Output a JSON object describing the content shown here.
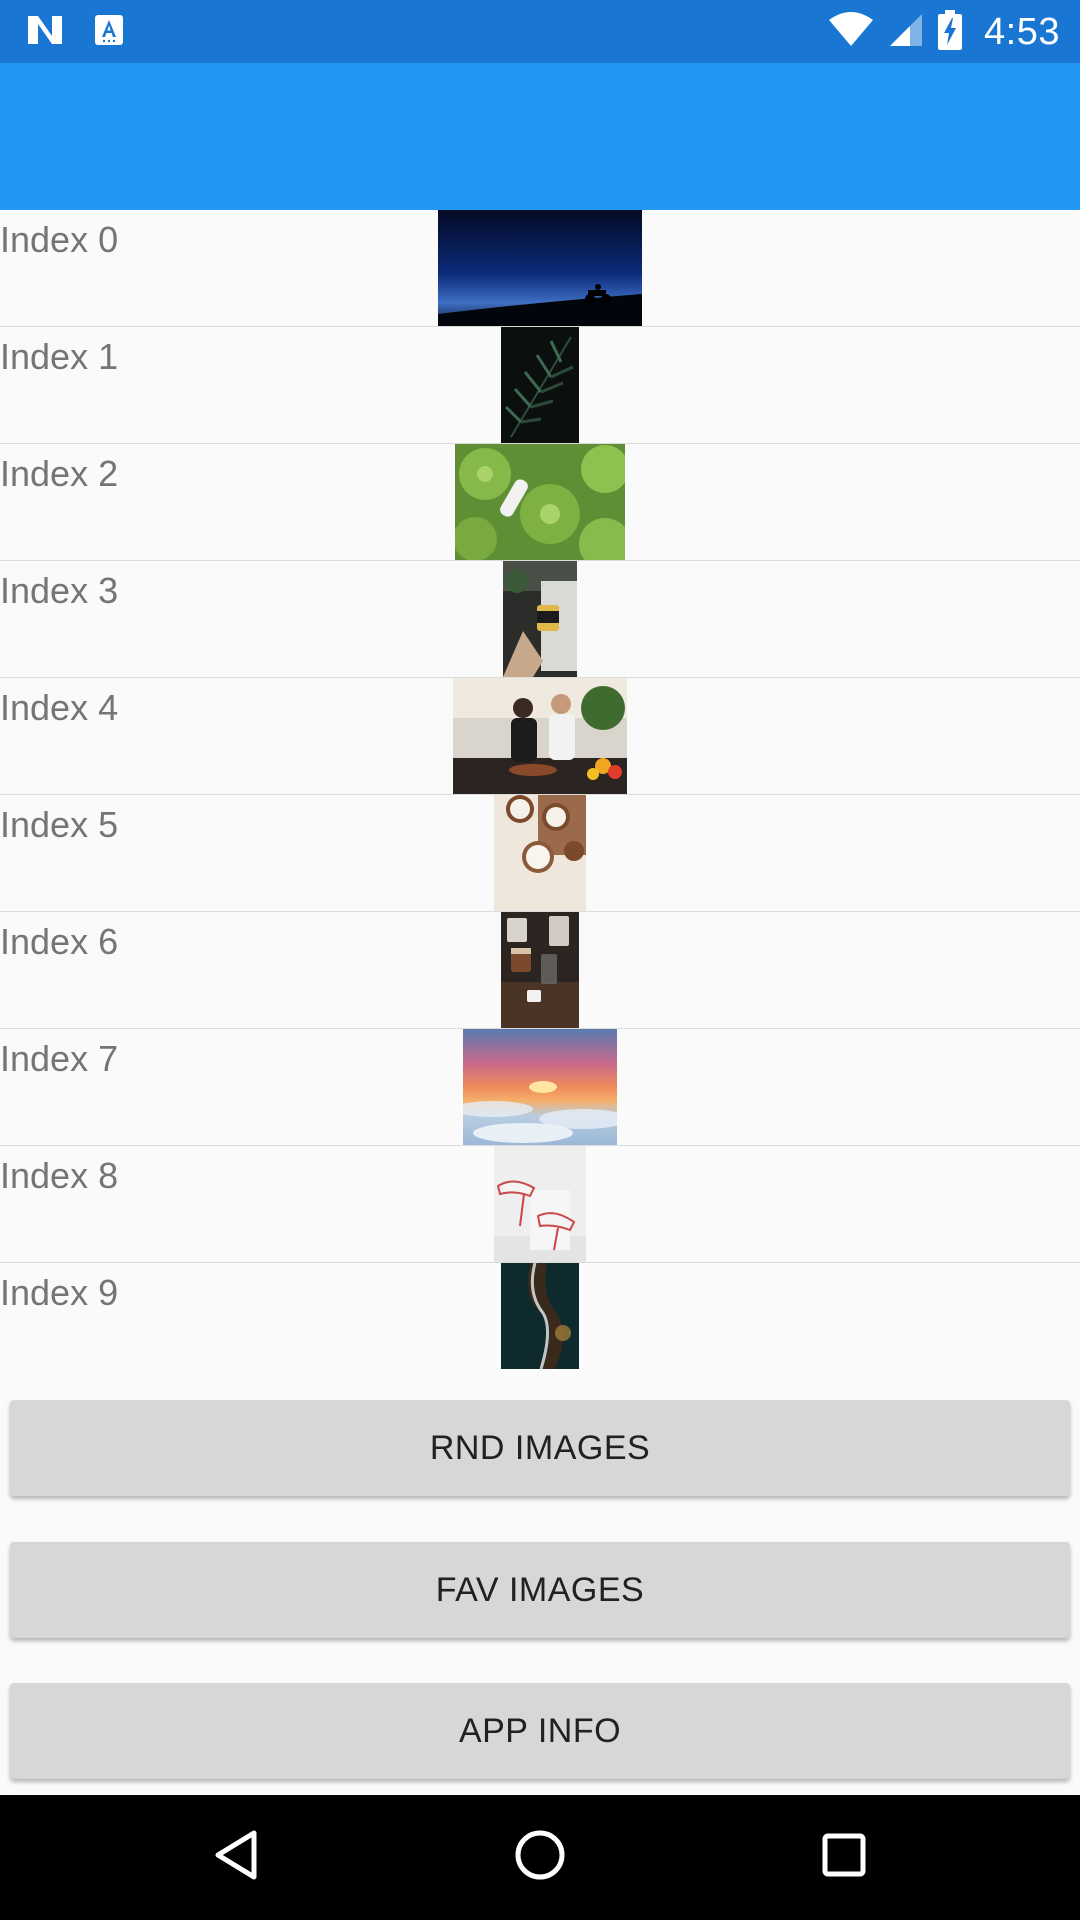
{
  "status_bar": {
    "time": "4:53",
    "background_color": "#1976d2",
    "icons": [
      "notification-n-icon",
      "app-a-icon",
      "wifi-icon",
      "signal-icon",
      "battery-charging-icon"
    ]
  },
  "app_bar": {
    "background_color": "#2196f3"
  },
  "list": {
    "items": [
      {
        "label": "Index 0"
      },
      {
        "label": "Index 1"
      },
      {
        "label": "Index 2"
      },
      {
        "label": "Index 3"
      },
      {
        "label": "Index 4"
      },
      {
        "label": "Index 5"
      },
      {
        "label": "Index 6"
      },
      {
        "label": "Index 7"
      },
      {
        "label": "Index 8"
      },
      {
        "label": "Index 9"
      }
    ]
  },
  "buttons": {
    "rnd_images": "RND IMAGES",
    "fav_images": "FAV IMAGES",
    "app_info": "APP INFO"
  },
  "nav_bar": {
    "icons": [
      "back-icon",
      "home-icon",
      "recents-icon"
    ]
  }
}
